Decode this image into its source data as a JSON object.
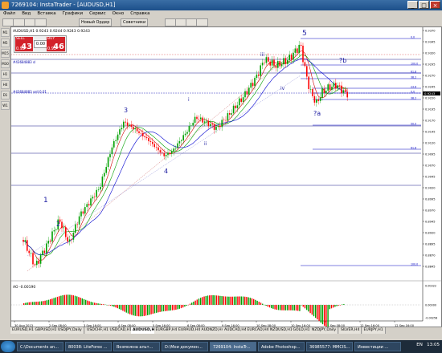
{
  "window": {
    "title": "7269104: InstaTrader - [AUDUSD,H1]"
  },
  "menu": [
    "Файл",
    "Вид",
    "Вставка",
    "Графики",
    "Сервис",
    "Окно",
    "Справка"
  ],
  "toolbar": {
    "new_order": "Новый Ордер",
    "advisors": "Советники"
  },
  "chart": {
    "header": "AUDUSD,H1  0.9243 0.9244 0.9243 0.9243",
    "price_labels": [
      "0.9370",
      "0.9345",
      "0.9320",
      "0.9295",
      "0.9270",
      "0.9245",
      "0.9220",
      "0.9195",
      "0.9170",
      "0.9145",
      "0.9120",
      "0.9095",
      "0.9070",
      "0.9045",
      "0.9020",
      "0.8995",
      "0.8970",
      "0.8945",
      "0.8920",
      "0.8895",
      "0.8870",
      "0.8845"
    ],
    "current_price": "0.9243",
    "time_labels": [
      "30 Aug 2013",
      "2 Sep 08:00",
      "3 Sep 16:00",
      "4 Sep 08:00",
      "5 Sep 16:00",
      "6 Sep 08:00",
      "9 Sep 16:00",
      "10 Sep 08:00",
      "10 Sep 16:00",
      "11 Sep 08:00",
      "12 Sep 16:00",
      "12 Sep 16:00"
    ],
    "wave_labels": [
      "1",
      "2",
      "3",
      "4",
      "5",
      "i",
      "ii",
      "iii",
      "iv",
      "?a",
      "?b"
    ],
    "fib_labels": [
      "0.0",
      "100.0",
      "61.8",
      "38.2",
      "23.6",
      "0.0",
      "38.2",
      "50.0",
      "61.8",
      "100.0"
    ],
    "order_labels": [
      "#43684883 sell 0.01",
      "#43684883 sl"
    ]
  },
  "trade_panel": {
    "sell_label": "SELL",
    "buy_label": "BUY",
    "sell_small": "0.92",
    "sell_big": "43",
    "buy_small": "0.92",
    "buy_big": "46",
    "lot": "0.00"
  },
  "ao": {
    "label": "AO  -0.00190",
    "levels": [
      "0.00322",
      "0.00000",
      "-0.00258"
    ]
  },
  "tabs": [
    "EURUSD,H1",
    "GBPUSD,H1",
    "USDJPY,Daily",
    "USDCHF,H1",
    "USDCAD,H1",
    "AUDUSD,H1",
    "EURGBP,H4",
    "EURAUD,H4",
    "AUDNZD,H4",
    "AUDCAD,H4",
    "EURCAD,H4",
    "NZDUSD,H1",
    "GOLD,H1",
    "NZDJPY,Daily",
    "SILVER,H4",
    "EURJPY,H1"
  ],
  "active_tab": "AUDUSD,H1",
  "taskbar": {
    "items": [
      "C:\\Documents an...",
      "80038: LiteForex ...",
      "Возможна альт...",
      "D:\\Мои докумен...",
      "7269104: InstaTr...",
      "Adobe Photoshop...",
      "36985577: MMCIS...",
      "Инвестиции ..."
    ],
    "active": "7269104: InstaTr...",
    "lang": "EN",
    "clock": "13:05"
  },
  "colors": {
    "bull": "#00a000",
    "bear": "#ff0000",
    "grid_line": "#1a1a8a",
    "fib": "#0000c0",
    "chart_bg": "#ffffff"
  }
}
